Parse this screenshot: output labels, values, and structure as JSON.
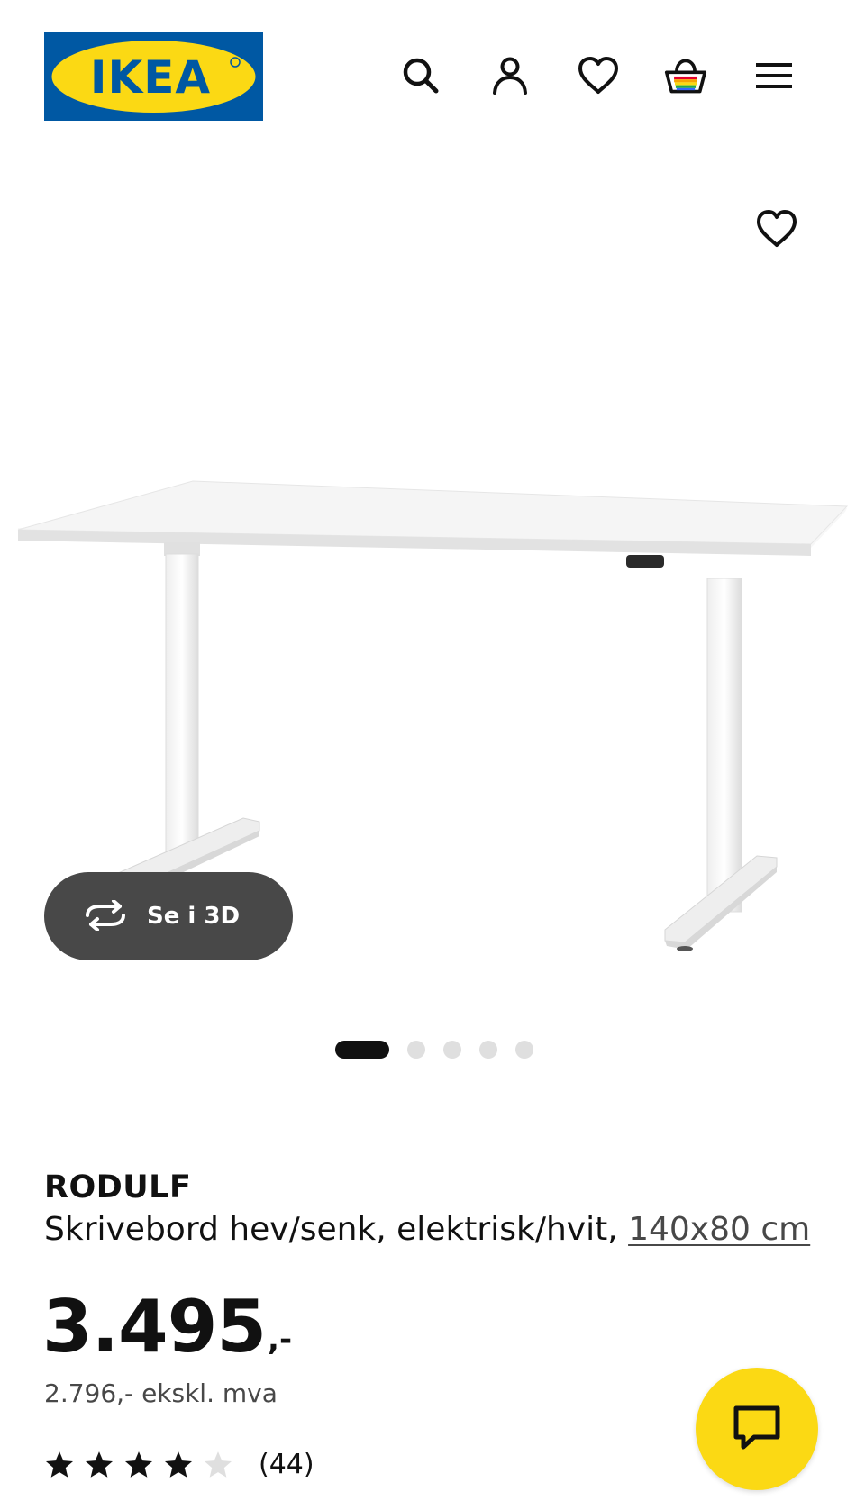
{
  "header": {
    "logo_text": "IKEA",
    "icons": [
      "search-icon",
      "account-icon",
      "wishlist-heart-icon",
      "shopping-bag-icon",
      "hamburger-menu-icon"
    ]
  },
  "media": {
    "favourite_icon": "heart-icon",
    "view_3d_label": "Se i 3D",
    "pager": {
      "total": 5,
      "active": 1
    }
  },
  "product": {
    "name": "RODULF",
    "description": "Skrivebord hev/senk, elektrisk/hvit, ",
    "size_link": "140x80 cm",
    "price_integer": "3.495",
    "price_suffix": ",-",
    "price_excl_vat": "2.796,- ekskl. mva",
    "rating": {
      "value": 4,
      "max": 5,
      "count_label": "(44)"
    }
  },
  "chat": {
    "icon": "chat-bubble-icon"
  },
  "colors": {
    "ikea_blue": "#0058A3",
    "ikea_yellow": "#FBD914",
    "text_dark": "#111111",
    "text_secondary": "#484848",
    "pill_bg": "#484848"
  }
}
